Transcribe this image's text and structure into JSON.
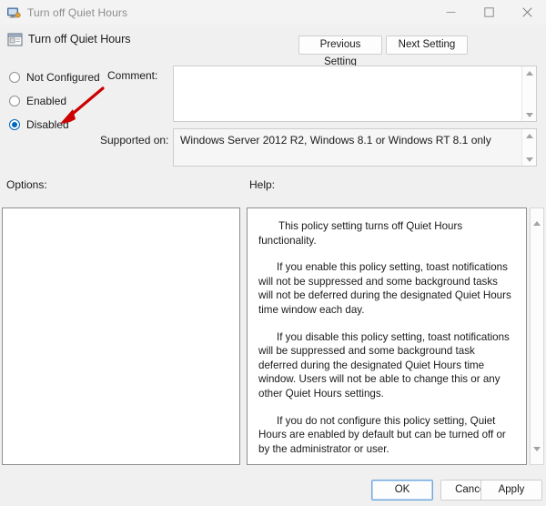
{
  "window": {
    "title": "Turn off Quiet Hours",
    "icon": "monitor-icon",
    "controls": {
      "minimize": "minimize-icon",
      "maximize": "maximize-icon",
      "close": "close-icon"
    }
  },
  "header": {
    "icon": "policy-setting-icon",
    "title": "Turn off Quiet Hours",
    "previous_setting_label": "Previous Setting",
    "next_setting_label": "Next Setting"
  },
  "state_options": {
    "items": [
      {
        "label": "Not Configured",
        "selected": false
      },
      {
        "label": "Enabled",
        "selected": false
      },
      {
        "label": "Disabled",
        "selected": true
      }
    ]
  },
  "comment": {
    "label": "Comment:",
    "value": "",
    "placeholder": ""
  },
  "supported_on": {
    "label": "Supported on:",
    "value": "Windows Server 2012 R2, Windows 8.1 or Windows RT 8.1 only"
  },
  "options": {
    "label": "Options:",
    "content": ""
  },
  "help": {
    "label": "Help:",
    "paragraphs": [
      "This policy setting turns off Quiet Hours functionality.",
      "If you enable this policy setting, toast notifications will not be suppressed and some background tasks will not be deferred during the designated Quiet Hours time window each day.",
      "If you disable this policy setting, toast notifications will be suppressed and some background task deferred during the designated Quiet Hours time window.  Users will not be able to change this or any other Quiet Hours settings.",
      "If you do not configure this policy setting, Quiet Hours are enabled by default but can be turned off or by the administrator or user."
    ]
  },
  "footer": {
    "ok_label": "OK",
    "cancel_label": "Cancel",
    "apply_label": "Apply"
  },
  "annotation": {
    "arrow_color": "#cc0000",
    "points_to": "Disabled"
  },
  "colors": {
    "accent": "#0067c0",
    "dialog_bg": "#f0f0f0",
    "panel_bg": "#ffffff",
    "panel_border": "#8e8e8e",
    "annotation_red": "#cc0000"
  }
}
